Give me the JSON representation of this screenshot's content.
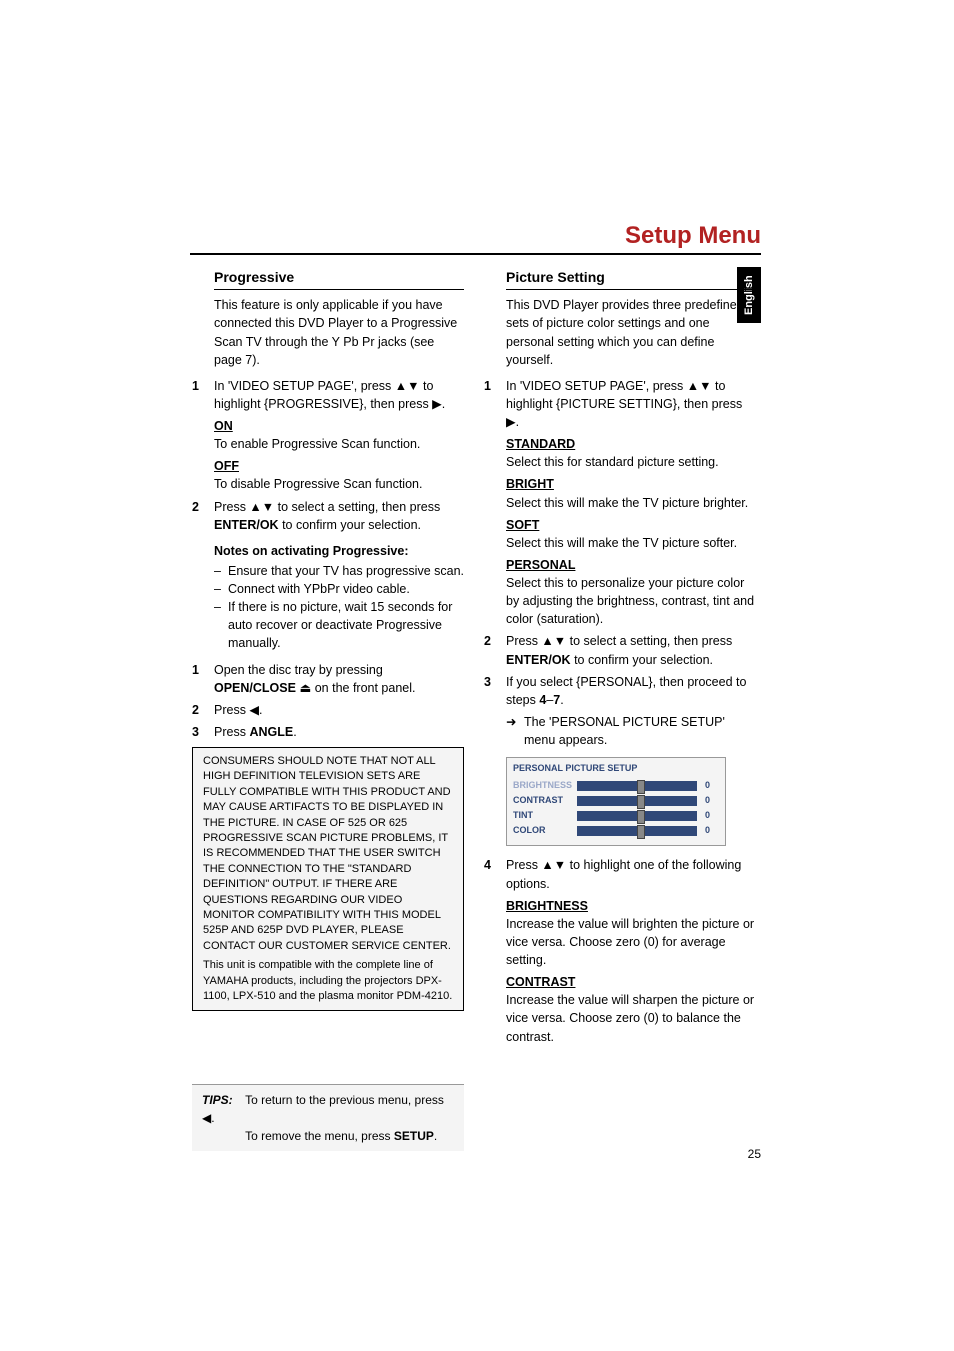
{
  "title": "Setup Menu",
  "language_tab": "English",
  "left": {
    "heading": "Progressive",
    "intro": "This feature is only applicable if you have connected this DVD Player to a Progressive Scan TV through the Y Pb Pr jacks (see page 7).",
    "step1": "In 'VIDEO SETUP PAGE', press ▲▼ to highlight {PROGRESSIVE}, then press ▶.",
    "on_label": "ON",
    "on_desc": "To enable Progressive Scan function.",
    "off_label": "OFF",
    "off_desc": "To disable Progressive Scan function.",
    "step2_a": "Press ▲▼ to select a setting, then press ",
    "step2_b": "ENTER/OK",
    "step2_c": " to confirm your selection.",
    "notes_head": "Notes on activating Progressive:",
    "note1": "Ensure that your TV has progressive scan.",
    "note2": "Connect with YPbPr video cable.",
    "note3": "If there is no picture, wait 15 seconds for auto recover or deactivate Progressive manually.",
    "open1_a": "Open the disc tray by pressing ",
    "open1_b": "OPEN/CLOSE",
    "open1_c": " ⏏ on the front panel.",
    "open2": "Press ◀.",
    "open3_a": "Press ",
    "open3_b": "ANGLE",
    "open3_c": ".",
    "notice_main": "CONSUMERS SHOULD NOTE THAT NOT ALL HIGH DEFINITION TELEVISION SETS ARE FULLY COMPATIBLE WITH THIS PRODUCT AND MAY CAUSE ARTIFACTS TO BE DISPLAYED IN THE PICTURE. IN CASE OF 525 OR 625 PROGRESSIVE SCAN PICTURE PROBLEMS, IT IS RECOMMENDED THAT THE USER SWITCH THE CONNECTION TO THE \"STANDARD DEFINITION\" OUTPUT. IF THERE ARE QUESTIONS REGARDING OUR VIDEO MONITOR COMPATIBILITY WITH THIS MODEL 525P AND 625P DVD PLAYER, PLEASE CONTACT OUR CUSTOMER SERVICE CENTER.",
    "notice_sub": "This unit is compatible with the complete line of YAMAHA products, including the projectors DPX-1100, LPX-510 and the plasma monitor PDM-4210."
  },
  "right": {
    "heading": "Picture Setting",
    "intro": "This DVD Player provides three predefined sets of picture color settings and one personal setting which you can define yourself.",
    "step1": "In 'VIDEO SETUP PAGE', press ▲▼ to highlight {PICTURE SETTING}, then press ▶.",
    "standard_label": "STANDARD",
    "standard_desc": "Select this for standard picture setting.",
    "bright_label": "BRIGHT",
    "bright_desc": "Select this will make the TV picture brighter.",
    "soft_label": "SOFT",
    "soft_desc": "Select this will make the TV picture softer.",
    "personal_label": "PERSONAL",
    "personal_desc": "Select this to personalize your picture color by adjusting the brightness, contrast, tint and color (saturation).",
    "step2_a": "Press ▲▼ to select a setting, then press ",
    "step2_b": "ENTER/OK",
    "step2_c": " to confirm your selection.",
    "step3_a": "If you select {PERSONAL}, then proceed to steps ",
    "step3_b": "4",
    "step3_c": "–",
    "step3_d": "7",
    "step3_e": ".",
    "arrow1": "The 'PERSONAL PICTURE SETUP' menu appears.",
    "pps": {
      "title": "PERSONAL PICTURE SETUP",
      "rows": [
        {
          "label": "BRIGHTNESS",
          "value": "0",
          "active": true
        },
        {
          "label": "CONTRAST",
          "value": "0",
          "active": false
        },
        {
          "label": "TINT",
          "value": "0",
          "active": false
        },
        {
          "label": "COLOR",
          "value": "0",
          "active": false
        }
      ]
    },
    "step4": "Press ▲▼ to highlight one of the following options.",
    "brightness_label": "BRIGHTNESS",
    "brightness_desc": "Increase the value will brighten the picture or vice versa. Choose zero (0) for average setting.",
    "contrast_label": "CONTRAST",
    "contrast_desc": "Increase the value will sharpen the picture or vice versa. Choose zero (0) to balance the contrast."
  },
  "tips": {
    "label": "TIPS:",
    "line1": "To return to the previous menu, press ◀.",
    "line2_a": "To remove the menu, press ",
    "line2_b": "SETUP",
    "line2_c": "."
  },
  "page_num": "25"
}
